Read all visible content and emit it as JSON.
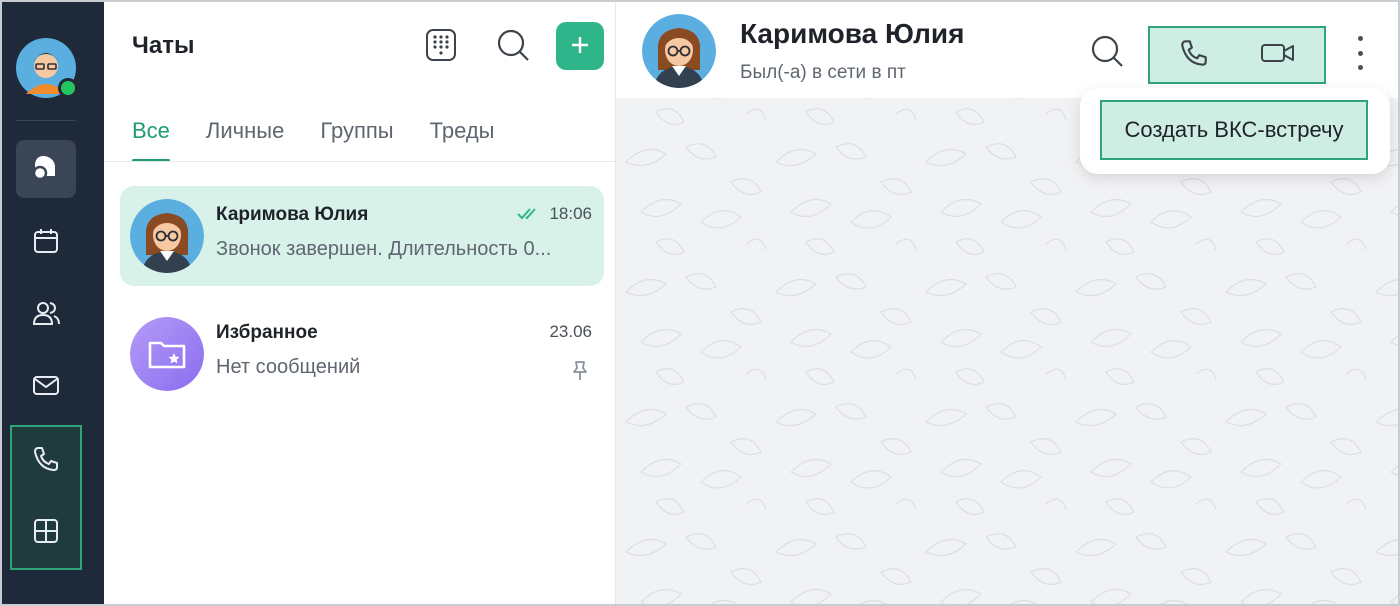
{
  "chats": {
    "title": "Чаты",
    "tabs": [
      "Все",
      "Личные",
      "Группы",
      "Треды"
    ],
    "items": [
      {
        "name": "Каримова Юлия",
        "time": "18:06",
        "preview": "Звонок завершен. Длительность 0...",
        "read": true,
        "selected": true
      },
      {
        "name": "Избранное",
        "time": "23.06",
        "preview": "Нет сообщений",
        "pinned": true
      }
    ]
  },
  "conversation": {
    "name": "Каримова Юлия",
    "status": "Был(-а) в сети в пт",
    "menu_item": "Создать ВКС-встречу"
  },
  "rail": {
    "items": [
      "chats-icon",
      "calendar-icon",
      "contacts-icon",
      "mail-icon",
      "phone-icon",
      "apps-icon"
    ]
  },
  "colors": {
    "accent": "#2fb589",
    "rail_bg": "#1e2a3a",
    "selected_bg": "#d8f2ea"
  }
}
